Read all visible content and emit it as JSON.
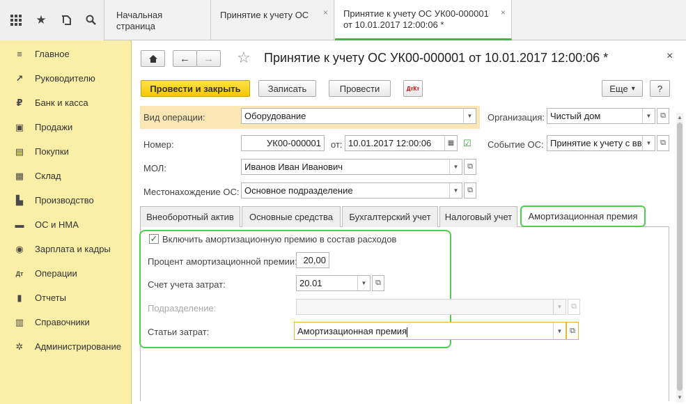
{
  "topbar": {
    "tabs": [
      {
        "label": "Начальная страница"
      },
      {
        "label": "Принятие к учету ОС"
      },
      {
        "label": "Принятие к учету ОС УК00-000001\nот 10.01.2017 12:00:06 *"
      }
    ],
    "close_glyph": "×"
  },
  "icons": {
    "apps": "apps-grid-icon",
    "star": "star-icon",
    "history": "history-icon",
    "search": "search-icon"
  },
  "sidebar": {
    "items": [
      {
        "label": "Главное",
        "icon": "menu-icon",
        "glyph": "≡"
      },
      {
        "label": "Руководителю",
        "icon": "trend-icon",
        "glyph": "↗"
      },
      {
        "label": "Банк и касса",
        "icon": "coin-icon",
        "glyph": "₽"
      },
      {
        "label": "Продажи",
        "icon": "cart-icon",
        "glyph": "▣"
      },
      {
        "label": "Покупки",
        "icon": "basket-icon",
        "glyph": "▤"
      },
      {
        "label": "Склад",
        "icon": "warehouse-icon",
        "glyph": "▦"
      },
      {
        "label": "Производство",
        "icon": "factory-icon",
        "glyph": "▙"
      },
      {
        "label": "ОС и НМА",
        "icon": "truck-icon",
        "glyph": "▬"
      },
      {
        "label": "Зарплата и кадры",
        "icon": "people-icon",
        "glyph": "◉"
      },
      {
        "label": "Операции",
        "icon": "dt-kt-icon",
        "glyph": "Дт"
      },
      {
        "label": "Отчеты",
        "icon": "bar-chart-icon",
        "glyph": "▮"
      },
      {
        "label": "Справочники",
        "icon": "book-icon",
        "glyph": "▥"
      },
      {
        "label": "Администрирование",
        "icon": "gear-icon",
        "glyph": "✲"
      }
    ]
  },
  "header": {
    "title": "Принятие к учету ОС УК00-000001 от 10.01.2017 12:00:06 *",
    "star_glyph": "☆",
    "close_glyph": "×"
  },
  "toolbar": {
    "post_close": "Провести и закрыть",
    "save": "Записать",
    "post": "Провести",
    "more": "Еще",
    "more_arrow": "▾",
    "help": "?",
    "dtkt": "ДтКт"
  },
  "form": {
    "operation_label": "Вид операции:",
    "operation_value": "Оборудование",
    "org_label": "Организация:",
    "org_value": "Чистый дом",
    "number_label": "Номер:",
    "number_value": "УК00-000001",
    "date_label": "от:",
    "date_value": "10.01.2017 12:00:06",
    "event_label": "Событие ОС:",
    "event_value": "Принятие к учету с вв",
    "mol_label": "МОЛ:",
    "mol_value": "Иванов Иван Иванович",
    "location_label": "Местонахождение ОС:",
    "location_value": "Основное подразделение"
  },
  "tabs": [
    {
      "label": "Внеоборотный актив"
    },
    {
      "label": "Основные средства"
    },
    {
      "label": "Бухгалтерский учет"
    },
    {
      "label": "Налоговый учет"
    },
    {
      "label": "Амортизационная премия"
    }
  ],
  "premium": {
    "include_label": "Включить амортизационную премию в состав расходов",
    "include_checked": true,
    "check_glyph": "✓",
    "percent_label": "Процент амортизационной премии:",
    "percent_value": "20,00",
    "account_label": "Счет учета затрат:",
    "account_value": "20.01",
    "department_label": "Подразделение:",
    "department_value": "",
    "cost_label": "Статьи затрат:",
    "cost_value": "Амортизационная премия"
  },
  "colors": {
    "sidebar": "#fbeea7",
    "primary_button": "#f5c800",
    "highlight": "#fbe7b3",
    "annotation_green": "#4cd14c"
  }
}
